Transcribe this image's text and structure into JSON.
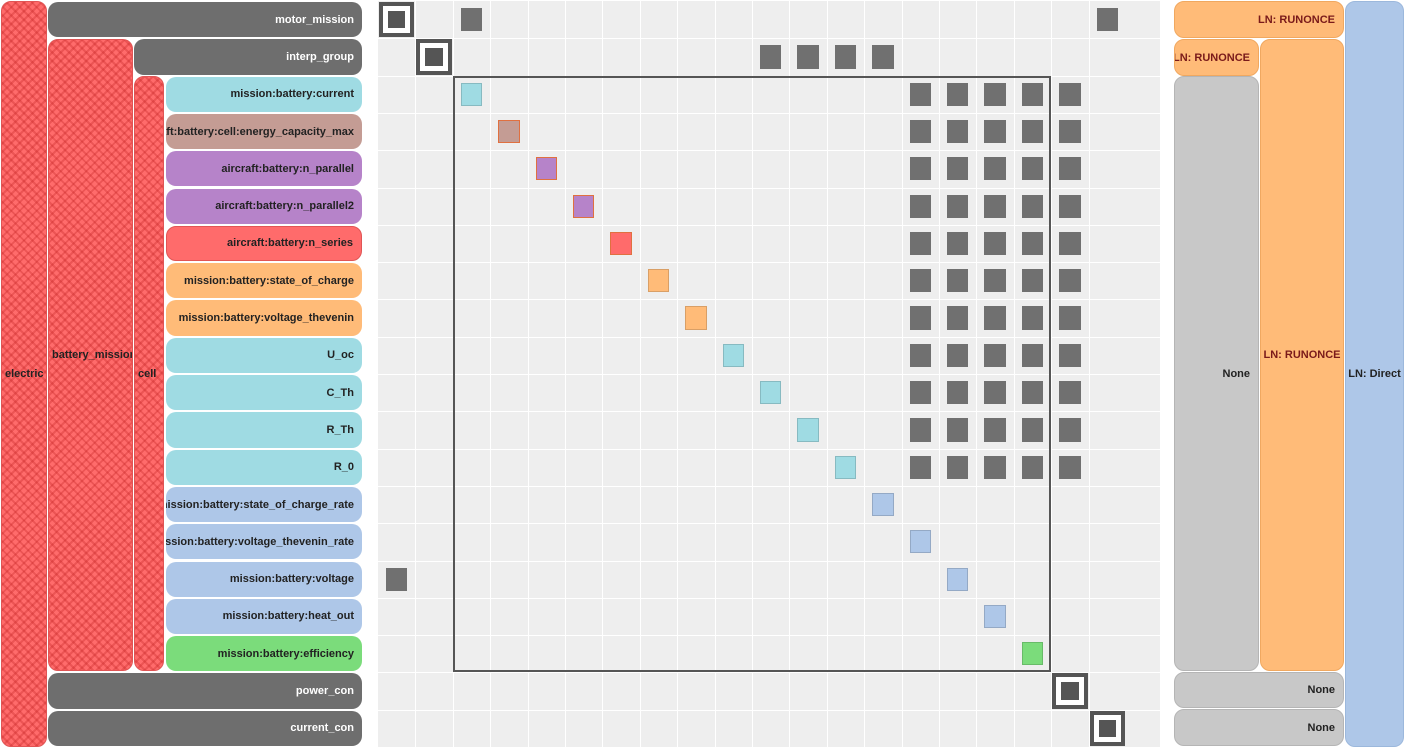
{
  "groups": {
    "electric": "electric",
    "battery_mission": "battery_mission",
    "cell": "cell"
  },
  "rows": [
    {
      "label": "motor_mission",
      "color": "#6e6e6e",
      "kind": "system"
    },
    {
      "label": "interp_group",
      "color": "#6e6e6e",
      "kind": "system"
    },
    {
      "label": "mission:battery:current",
      "color": "#9fdbe3",
      "kind": "var"
    },
    {
      "label": "aircraft:battery:cell:energy_capacity_max",
      "color": "#c49c94",
      "kind": "var"
    },
    {
      "label": "aircraft:battery:n_parallel",
      "color": "#b683c9",
      "kind": "var"
    },
    {
      "label": "aircraft:battery:n_parallel2",
      "color": "#b683c9",
      "kind": "var"
    },
    {
      "label": "aircraft:battery:n_series",
      "color": "#ff6b6b",
      "kind": "var"
    },
    {
      "label": "mission:battery:state_of_charge",
      "color": "#ffbb78",
      "kind": "var"
    },
    {
      "label": "mission:battery:voltage_thevenin",
      "color": "#ffbb78",
      "kind": "var"
    },
    {
      "label": "U_oc",
      "color": "#9fdbe3",
      "kind": "var"
    },
    {
      "label": "C_Th",
      "color": "#9fdbe3",
      "kind": "var"
    },
    {
      "label": "R_Th",
      "color": "#9fdbe3",
      "kind": "var"
    },
    {
      "label": "R_0",
      "color": "#9fdbe3",
      "kind": "var"
    },
    {
      "label": "mission:battery:state_of_charge_rate",
      "color": "#aec7e8",
      "kind": "var"
    },
    {
      "label": "mission:battery:voltage_thevenin_rate",
      "color": "#aec7e8",
      "kind": "var"
    },
    {
      "label": "mission:battery:voltage",
      "color": "#aec7e8",
      "kind": "var"
    },
    {
      "label": "mission:battery:heat_out",
      "color": "#aec7e8",
      "kind": "var"
    },
    {
      "label": "mission:battery:efficiency",
      "color": "#7bdc7b",
      "kind": "var"
    },
    {
      "label": "power_con",
      "color": "#6e6e6e",
      "kind": "system"
    },
    {
      "label": "current_con",
      "color": "#6e6e6e",
      "kind": "system"
    }
  ],
  "offdiag": [
    [
      0,
      2
    ],
    [
      0,
      19
    ],
    [
      1,
      10
    ],
    [
      1,
      11
    ],
    [
      1,
      12
    ],
    [
      1,
      13
    ],
    [
      2,
      14
    ],
    [
      2,
      15
    ],
    [
      2,
      16
    ],
    [
      2,
      17
    ],
    [
      2,
      18
    ],
    [
      3,
      14
    ],
    [
      3,
      15
    ],
    [
      3,
      16
    ],
    [
      3,
      17
    ],
    [
      3,
      18
    ],
    [
      4,
      14
    ],
    [
      4,
      15
    ],
    [
      4,
      16
    ],
    [
      4,
      17
    ],
    [
      4,
      18
    ],
    [
      5,
      14
    ],
    [
      5,
      15
    ],
    [
      5,
      16
    ],
    [
      5,
      17
    ],
    [
      5,
      18
    ],
    [
      6,
      14
    ],
    [
      6,
      15
    ],
    [
      6,
      16
    ],
    [
      6,
      17
    ],
    [
      6,
      18
    ],
    [
      7,
      14
    ],
    [
      7,
      15
    ],
    [
      7,
      16
    ],
    [
      7,
      17
    ],
    [
      7,
      18
    ],
    [
      8,
      14
    ],
    [
      8,
      15
    ],
    [
      8,
      16
    ],
    [
      8,
      17
    ],
    [
      8,
      18
    ],
    [
      9,
      14
    ],
    [
      9,
      15
    ],
    [
      9,
      16
    ],
    [
      9,
      17
    ],
    [
      9,
      18
    ],
    [
      10,
      14
    ],
    [
      10,
      15
    ],
    [
      10,
      16
    ],
    [
      10,
      17
    ],
    [
      10,
      18
    ],
    [
      11,
      14
    ],
    [
      11,
      15
    ],
    [
      11,
      16
    ],
    [
      11,
      17
    ],
    [
      11,
      18
    ],
    [
      12,
      14
    ],
    [
      12,
      15
    ],
    [
      12,
      16
    ],
    [
      12,
      17
    ],
    [
      12,
      18
    ],
    [
      15,
      0
    ]
  ],
  "solvers": {
    "top_label": "LN: RUNONCE",
    "interp_label": "LN: RUNONCE",
    "none_label": "None",
    "cell_label": "LN: RUNONCE",
    "direct_label": "LN: Direct",
    "power_none": "None",
    "current_none": "None"
  },
  "colors": {
    "system": "#6e6e6e",
    "solver_orange": "#ffbb78",
    "solver_gray": "#c8c8c8",
    "solver_blue": "#aec7e8",
    "hatch_red": "#ff6b6b",
    "grid_bg": "#eeeeee"
  }
}
